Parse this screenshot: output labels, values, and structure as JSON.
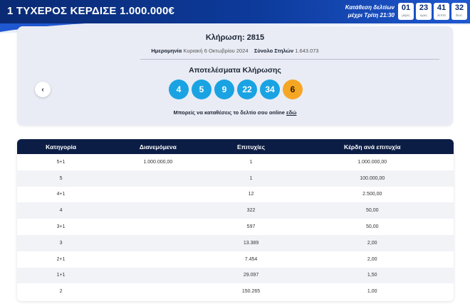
{
  "header": {
    "headline": "1 ΤΥΧΕΡΟΣ ΚΕΡΔΙΣΕ 1.000.000€",
    "deadline_line1": "Κατάθεση δελτίων",
    "deadline_line2": "μέχρι Τρίτη 21:30",
    "countdown": [
      {
        "value": "01",
        "unit": "μέρες"
      },
      {
        "value": "23",
        "unit": "ώρες"
      },
      {
        "value": "41",
        "unit": "λεπτά"
      },
      {
        "value": "32",
        "unit": "δευτ."
      }
    ]
  },
  "draw": {
    "title": "Κλήρωση: 2815",
    "date_label": "Ημερομηνία",
    "date_value": "Κυριακή 6 Οκτωβρίου 2024",
    "total_label": "Σύνολο Στηλών",
    "total_value": "1.643.073",
    "results_title": "Αποτελέσματα Κλήρωσης",
    "numbers": [
      "4",
      "5",
      "9",
      "22",
      "34"
    ],
    "joker": "6",
    "prev_label": "‹",
    "online_text": "Μπορείς να καταθέσεις το δελτίο σου online",
    "online_link": "εδώ"
  },
  "table": {
    "headers": [
      "Κατηγορία",
      "Διανεμόμενα",
      "Επιτυχίες",
      "Κέρδη ανά επιτυχία"
    ],
    "rows": [
      [
        "5+1",
        "1.000.000,00",
        "1",
        "1.000.000,00"
      ],
      [
        "5",
        "",
        "1",
        "100.000,00"
      ],
      [
        "4+1",
        "",
        "12",
        "2.500,00"
      ],
      [
        "4",
        "",
        "322",
        "50,00"
      ],
      [
        "3+1",
        "",
        "597",
        "50,00"
      ],
      [
        "3",
        "",
        "13.389",
        "2,00"
      ],
      [
        "2+1",
        "",
        "7.454",
        "2,00"
      ],
      [
        "1+1",
        "",
        "29.097",
        "1,50"
      ],
      [
        "2",
        "",
        "150.265",
        "1,00"
      ]
    ]
  },
  "colors": {
    "header_blue": "#0d3b9c",
    "ball_blue": "#1aa3e3",
    "joker_orange": "#f5a623",
    "table_header": "#0c1d45"
  }
}
